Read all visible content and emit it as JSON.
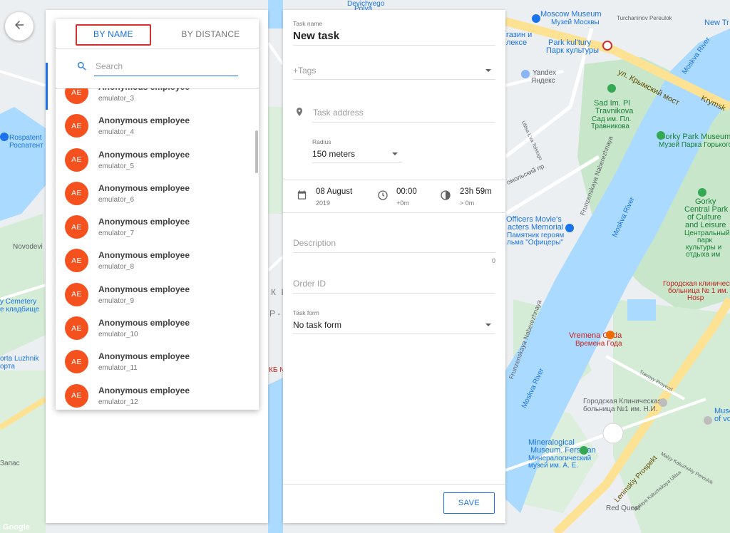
{
  "map": {
    "labels": {
      "moscow_museum": "Moscow Museum",
      "moscow_museum_ru": "Музей Москвы",
      "park_kultury": "Park kul'tury",
      "park_kultury_ru": "Парк культуры",
      "yandex": "Yandex",
      "yandex_ru": "Яндекс",
      "sad_im": "Sad Im. Pl",
      "travnikova": "Travnikova",
      "sad_ru_1": "Сад им. Пл.",
      "sad_ru_2": "Травникова",
      "krymsky": "ул. Крымский мост",
      "moskva_river_1": "Moskva River",
      "gorky_park_museum": "Gorky Park Museum",
      "gorky_park_museum_ru": "Музей Парка Горького",
      "gorky_1": "Gorky",
      "gorky_2": "Central Park",
      "gorky_3": "of Culture",
      "gorky_4": "and Leisure",
      "gorky_ru_1": "Центральный",
      "gorky_ru_2": "парк",
      "gorky_ru_3": "культуры и",
      "gorky_ru_4": "отдыха им",
      "officers_1": "Officers Movie's",
      "officers_2": "acters Memorial",
      "officers_ru_1": "Памятник героям",
      "officers_ru_2": "льма \"Офицеры\"",
      "rospatent": "Rospatent",
      "rospatent_ru": "Роспатент",
      "novodevi": "Novodevi",
      "cemetery_1": "y Cemetery",
      "cemetery_2": "е кладбище",
      "luzhniki_1": "orta Luzhnik",
      "luzhniki_2": "орта",
      "vremena_goda": "Vremena Goda",
      "vremena_goda_ru": "Времена Года",
      "hospital_ru_1": "Городская клинически",
      "hospital_ru_2": "больница № 1 им.",
      "hospital_ru_3": "Hosp",
      "hospital2_1": "Городская Клиническая",
      "hospital2_2": "больница №1 им. Н.И.",
      "mineral_1": "Mineralogical",
      "mineral_2": "Museum. Fersman",
      "mineral_ru_1": "Минералогический",
      "mineral_ru_2": "музей им. А. Е.",
      "red_quest": "Red Quest",
      "leninsky": "Leninskiy Prospekt",
      "frunzenskaya": "Frunzenskaya Naberezhnaya",
      "moskva_river_2": "Moskva River",
      "moskva_river_3": "Moskva River",
      "pushkinskaya_1": "New Tr",
      "tagansky": "Turchaninov Pereulok",
      "devichyego": "Devichyego",
      "polya": "Polya",
      "kazin_1": "газин и",
      "kazin_2": "лексе",
      "museum_of_1": "Museu",
      "museum_of_2": "of vo",
      "krymskiy": "Krymsk",
      "kyrill": "К І",
      "p_line": "Р - Н",
      "kb": "КБ №",
      "zapas": "Запас",
      "google": "Google",
      "travny_proyezd": "Travnyy Proyezd",
      "malyy_kaluzh": "Malyy Kaluzhskiy Pereulok",
      "malaya_kaluzh": "Malaya Kaluzhskaya Ulitsa",
      "ulitsa_lva": "Ulitsa L'va Tolstogo",
      "komsomol": "омольский пр.",
      "frunz_2": "Frunzenskaya Naberezhnaya"
    }
  },
  "back_button": {
    "icon": "arrow-left-icon"
  },
  "picker": {
    "tabs": [
      {
        "label": "BY NAME",
        "active": true
      },
      {
        "label": "BY DISTANCE",
        "active": false
      }
    ],
    "search": {
      "placeholder": "Search",
      "value": ""
    },
    "employees": [
      {
        "initials": "AE",
        "name": "Anonymous employee",
        "login": "emulator_3"
      },
      {
        "initials": "AE",
        "name": "Anonymous employee",
        "login": "emulator_4"
      },
      {
        "initials": "AE",
        "name": "Anonymous employee",
        "login": "emulator_5"
      },
      {
        "initials": "AE",
        "name": "Anonymous employee",
        "login": "emulator_6"
      },
      {
        "initials": "AE",
        "name": "Anonymous employee",
        "login": "emulator_7"
      },
      {
        "initials": "AE",
        "name": "Anonymous employee",
        "login": "emulator_8"
      },
      {
        "initials": "AE",
        "name": "Anonymous employee",
        "login": "emulator_9"
      },
      {
        "initials": "AE",
        "name": "Anonymous employee",
        "login": "emulator_10"
      },
      {
        "initials": "AE",
        "name": "Anonymous employee",
        "login": "emulator_11"
      },
      {
        "initials": "AE",
        "name": "Anonymous employee",
        "login": "emulator_12"
      }
    ]
  },
  "task": {
    "name_label": "Task name",
    "name_value": "New task",
    "tags_label": "+Tags",
    "address_placeholder": "Task address",
    "radius_label": "Radius",
    "radius_value": "150 meters",
    "date_main": "08 August",
    "date_sub": "2019",
    "time_main": "00:00",
    "time_sub": "+0m",
    "duration_main": "23h 59m",
    "duration_sub": "> 0m",
    "description_placeholder": "Description",
    "description_counter": "0",
    "order_id_placeholder": "Order ID",
    "task_form_label": "Task form",
    "task_form_value": "No task form",
    "save_label": "SAVE"
  },
  "colors": {
    "accent": "#1a73e8",
    "avatar": "#f4511e",
    "highlight_box": "#d32f2f",
    "water": "#aadaff",
    "park": "#c8e6c9",
    "main_road": "#fde293"
  }
}
